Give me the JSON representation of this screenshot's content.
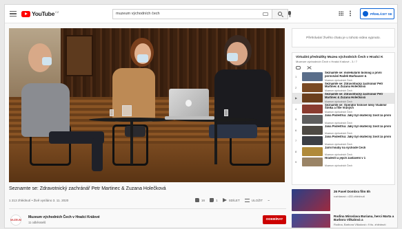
{
  "header": {
    "logo_text": "YouTube",
    "logo_country": "CZ",
    "search_value": "muzeum východních čech",
    "signin_label": "PŘIHLÁSIT SE"
  },
  "video": {
    "title": "Seznamte se: Zdravotnický zachránář Petr Martinec & Zuzana Holečková",
    "meta": "1 213 zhlédnutí • Živě vysíláno 3. 11. 2020",
    "likes": "16",
    "dislikes": "1",
    "share_label": "SDÍLET",
    "save_label": "ULOŽIT",
    "more_label": "..."
  },
  "channel": {
    "avatar_text": "MUZEUM",
    "name": "Muzeum východních Čech v Hradci Králové",
    "subscribers": "11 odběratelů",
    "subscribe_label": "ODEBÍRAT"
  },
  "chat": {
    "message": "Přehrávání živého chatu je u tohoto videa vypnuto."
  },
  "playlist": {
    "title": "Virtuální přednášky Muzea východních Čech v Hradci K",
    "subtitle": "Muzeum východních Čech v Hradci Králové - 3 / 7",
    "items": [
      {
        "index": "1",
        "title": "Seznamte se: molekulární bioloog a první porovnání Radek Marhauser &",
        "channel": "Muzeum východních Čech",
        "color": "#5a6e8a"
      },
      {
        "index": "2",
        "title": "Seznamte se: Zdravotnický zachránář Petr Martinec & Zuzana Holečková",
        "channel": "Muzeum východních Čech",
        "color": "#7a4a24"
      },
      {
        "index": "▶",
        "title": "Seznamte se: Zdravotnický zachránář Petr Martinec & Zuzana Holečková",
        "channel": "Muzeum východních Čech",
        "color": "#6b3f1d"
      },
      {
        "index": "4",
        "title": "Seznamte se: Operátor tísňové linky Vladimír Šimka a říše Vraných",
        "channel": "Muzeum východních Čech",
        "color": "#8a3c30"
      },
      {
        "index": "5",
        "title": "Jana Podešťka: Jaký byl skutečný život za první",
        "channel": "Muzeum východních Čech",
        "color": "#5e5e5e"
      },
      {
        "index": "6",
        "title": "Jana Podešťka: Jaký byl skutečný život za první",
        "channel": "Muzeum východních Čech",
        "color": "#4e4a44"
      },
      {
        "index": "7",
        "title": "Jana Podešťka: Jaký byl skutečný život za první",
        "channel": "Muzeum východních Čech",
        "color": "#3c3f45"
      },
      {
        "index": "8",
        "title": "Jarní houby na východě Čech",
        "channel": "Muzeum východních Čech",
        "color": "#b08a3a"
      },
      {
        "index": "9",
        "title": "Hradečtí a jejich zastavení v 1",
        "channel": "Muzeum východních Čech",
        "color": "#9a8466"
      }
    ]
  },
  "recommended": [
    {
      "title": "26 Pavel Dombra film 5h",
      "sub": "rozhlasná • 433 zhlédnutí",
      "color": "#2a3f86"
    },
    {
      "title": "Rodina Miroslava Buriana, herci Marta a Barbora Vilkalová a",
      "sub": "Rodina, Barbora Vilkalová • 9 tis. zhlédnutí",
      "color": "#3b4e9a"
    }
  ],
  "colors": {
    "accent": "#065fd4",
    "subscribe": "#cc0000",
    "youtube_red": "#ff0000"
  }
}
